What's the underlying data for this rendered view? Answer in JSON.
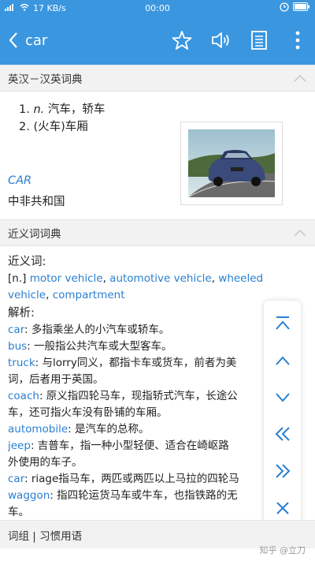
{
  "status": {
    "signal": "4G",
    "speed": "17 KB/s",
    "time": "00:00"
  },
  "toolbar": {
    "title": "car"
  },
  "section1": {
    "title": "英汉－汉英词典"
  },
  "definitions": [
    {
      "num": "1.",
      "pos": "n.",
      "text": "汽车，轿车"
    },
    {
      "num": "2.",
      "pos": "",
      "text": "(火车)车厢"
    }
  ],
  "abbr": {
    "code": "CAR",
    "meaning": "中非共和国"
  },
  "section2": {
    "title": "近义词词典"
  },
  "synonyms": {
    "label": "近义词:",
    "pos": "[n.]",
    "words": [
      "motor vehicle",
      "automotive vehicle",
      "wheeled vehicle",
      "compartment"
    ],
    "analysis_label": "解析:",
    "entries": [
      {
        "word": "car",
        "text": ": 多指乘坐人的小汽车或轿车。"
      },
      {
        "word": "bus",
        "text": ": 一般指公共汽车或大型客车。"
      },
      {
        "word": "truck",
        "text": ": 与lorry同义，都指卡车或货车，前者为美"
      },
      {
        "word": "",
        "text": "词，后者用于英国。"
      },
      {
        "word": "coach",
        "text": ": 原义指四轮马车，现指轿式汽车，长途公"
      },
      {
        "word": "",
        "text": "车，还可指火车没有卧铺的车厢。"
      },
      {
        "word": "automobile",
        "text": ": 是汽车的总称。"
      },
      {
        "word": "jeep",
        "text": ": 吉普车，指一种小型轻便、适合在崎岖路"
      },
      {
        "word": "",
        "text": "外使用的车子。"
      },
      {
        "word": "car",
        "text": ": riage指马车，两匹或两匹以上马拉的四轮马"
      },
      {
        "word": "waggon",
        "text": ": 指四轮运货马车或牛车，也指铁路的无"
      },
      {
        "word": "",
        "text": "车。"
      }
    ]
  },
  "section3": {
    "title": "词组 | 习惯用语"
  },
  "watermark": "知乎 @立刀"
}
